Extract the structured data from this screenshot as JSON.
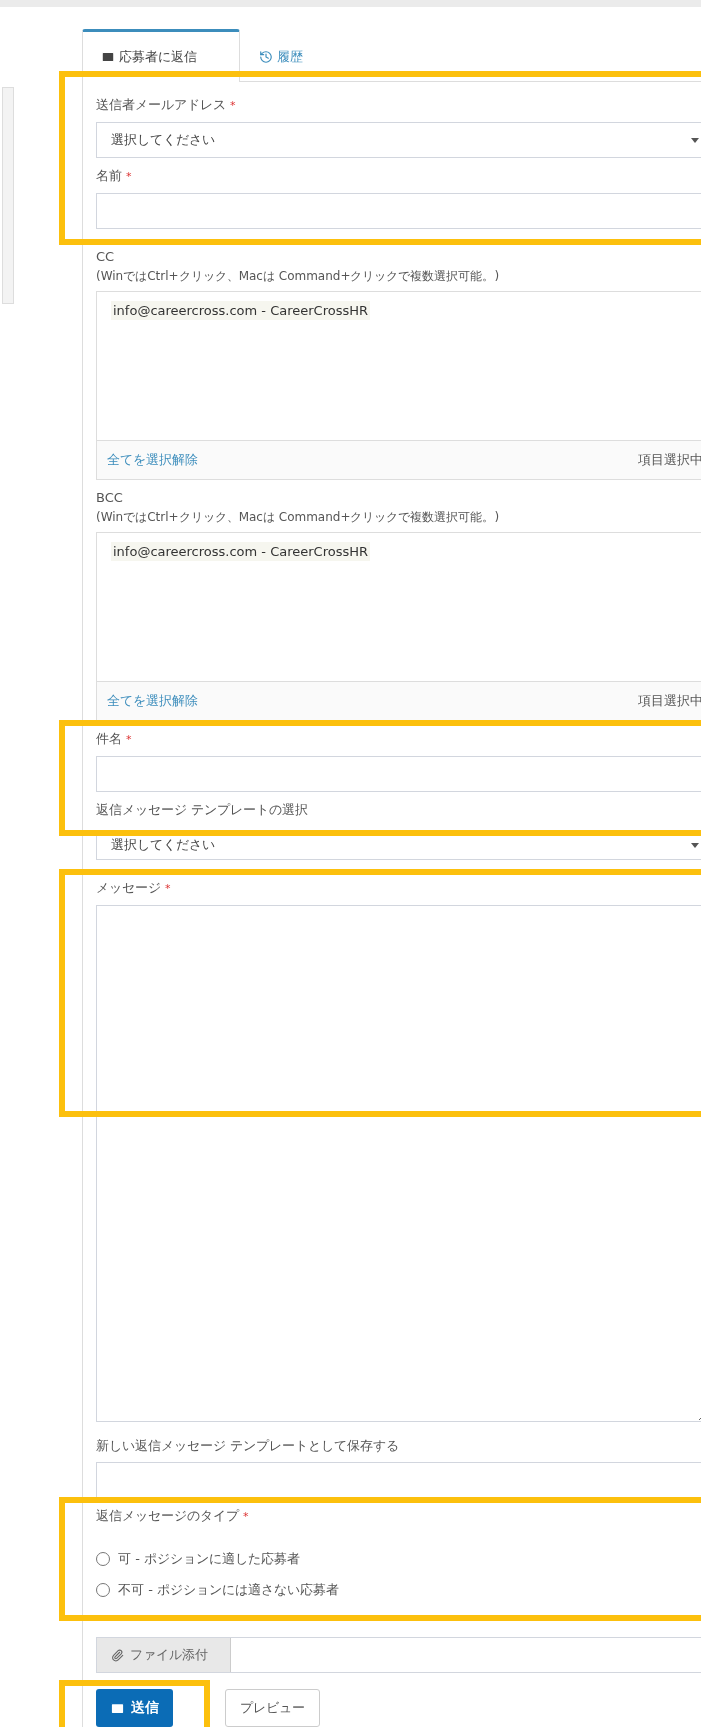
{
  "tabs": [
    {
      "label": "応募者に返信",
      "selected": true
    },
    {
      "label": "履歴",
      "selected": false
    }
  ],
  "fields": [
    {
      "kind": "select",
      "label": "送信者メールアドレス",
      "required_mark": "*",
      "value": "選択してください"
    },
    {
      "kind": "input",
      "label": "名前",
      "required_mark": "*"
    },
    {
      "kind": "listbox",
      "label": "CC",
      "hint": "(WinではCtrl+クリック、Macは Command+クリックで複数選択可能。)",
      "options": [
        {
          "label": "info@careercross.com - CareerCrossHR",
          "selected": true
        }
      ],
      "clear_link": "全てを選択解除",
      "status": "項目選択中"
    },
    {
      "kind": "listbox",
      "label": "BCC",
      "hint": "(WinではCtrl+クリック、Macは Command+クリックで複数選択可能。)",
      "options": [
        {
          "label": "info@careercross.com - CareerCrossHR",
          "selected": true
        }
      ],
      "clear_link": "全てを選択解除",
      "status": "項目選択中"
    },
    {
      "kind": "input",
      "label": "件名",
      "required_mark": "*"
    },
    {
      "kind": "select",
      "label": "返信メッセージ テンプレートの選択",
      "value": "選択してください"
    },
    {
      "kind": "textarea",
      "label": "メッセージ",
      "required_mark": "*"
    },
    {
      "kind": "input",
      "label": "新しい返信メッセージ テンプレートとして保存する"
    },
    {
      "kind": "radio",
      "label": "返信メッセージのタイプ",
      "required_mark": "*",
      "options": [
        {
          "label": "可 - ポジションに適した応募者",
          "selected": false
        },
        {
          "label": "不可 - ポジションには適さない応募者",
          "selected": false
        }
      ]
    }
  ],
  "attach_button": "ファイル添付",
  "send_button": "送信",
  "preview_button": "プレビュー",
  "highlight_frames": [
    {
      "kind": "frame"
    },
    {
      "kind": "frame"
    },
    {
      "kind": "frame"
    },
    {
      "kind": "frame"
    },
    {
      "kind": "frame"
    }
  ]
}
